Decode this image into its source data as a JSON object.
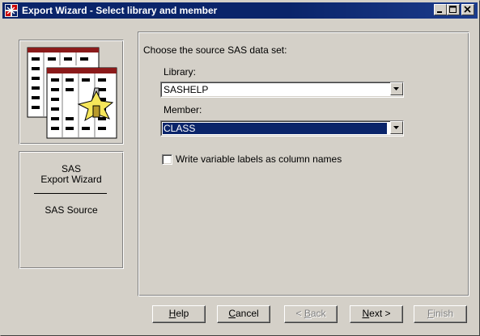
{
  "window": {
    "title": "Export Wizard - Select library and member",
    "controls": [
      "minimize-icon",
      "maximize-icon",
      "close-icon"
    ]
  },
  "sidebar": {
    "product": "SAS",
    "wizard_name": "Export Wizard",
    "step": "SAS Source"
  },
  "main": {
    "prompt": "Choose the source SAS data set:",
    "library_label": "Library:",
    "library_value": "SASHELP",
    "member_label": "Member:",
    "member_value": "CLASS",
    "checkbox_label": "Write variable labels as column names",
    "checkbox_checked": false
  },
  "buttons": {
    "help": {
      "accel": "H",
      "rest": "elp"
    },
    "cancel": {
      "accel": "C",
      "rest": "ancel"
    },
    "back": {
      "prefix": "< ",
      "accel": "B",
      "rest": "ack",
      "disabled": true
    },
    "next": {
      "accel": "N",
      "rest": "ext >"
    },
    "finish": {
      "accel": "F",
      "rest": "inish",
      "disabled": true
    }
  },
  "colors": {
    "titlebar": "#0a246a",
    "face": "#d4d0c8",
    "selection": "#0a246a",
    "table_header": "#8b1a1a",
    "export_arrow": "#f5e65a"
  }
}
